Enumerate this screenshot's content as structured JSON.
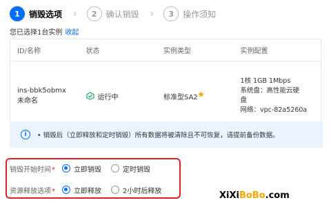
{
  "steps": [
    {
      "num": "1",
      "label": "销毁选项"
    },
    {
      "num": "2",
      "label": "确认销毁"
    },
    {
      "num": "3",
      "label": "操作须知"
    }
  ],
  "selection": {
    "text": "您已选择1台实例",
    "collapse_link": "收起"
  },
  "table": {
    "headers": [
      "ID/名称",
      "状态",
      "实例类型",
      "实例配置"
    ],
    "row": {
      "id": "ins-bbk5obmx",
      "name": "未命名",
      "status": "运行中",
      "type": "标准型SA2",
      "config_line1": "1核 1GB 1Mbps",
      "config_line2": "系统盘：高性能云硬",
      "config_line3": "盘",
      "config_line4": "网络：vpc-82a5260a"
    }
  },
  "notice": {
    "text": "• 销毁后（立即释放和定时销毁）所有数据将被清除且不可恢复，请提前备份数据。"
  },
  "form": {
    "destroy_time": {
      "label": "销毁开始时间",
      "opt1": "立即销毁",
      "opt2": "定时销毁",
      "selected": "立即销毁"
    },
    "release": {
      "label": "资源释放选项",
      "opt1": "立即释放",
      "opt2": "2小时后释放",
      "selected": "立即释放"
    }
  },
  "watermark": {
    "part1": "XiXi",
    "part2": "BoBo",
    "part3": ".com"
  },
  "colors": {
    "accent": "#006eff",
    "frame": "#e02020",
    "running": "#1aa861"
  }
}
